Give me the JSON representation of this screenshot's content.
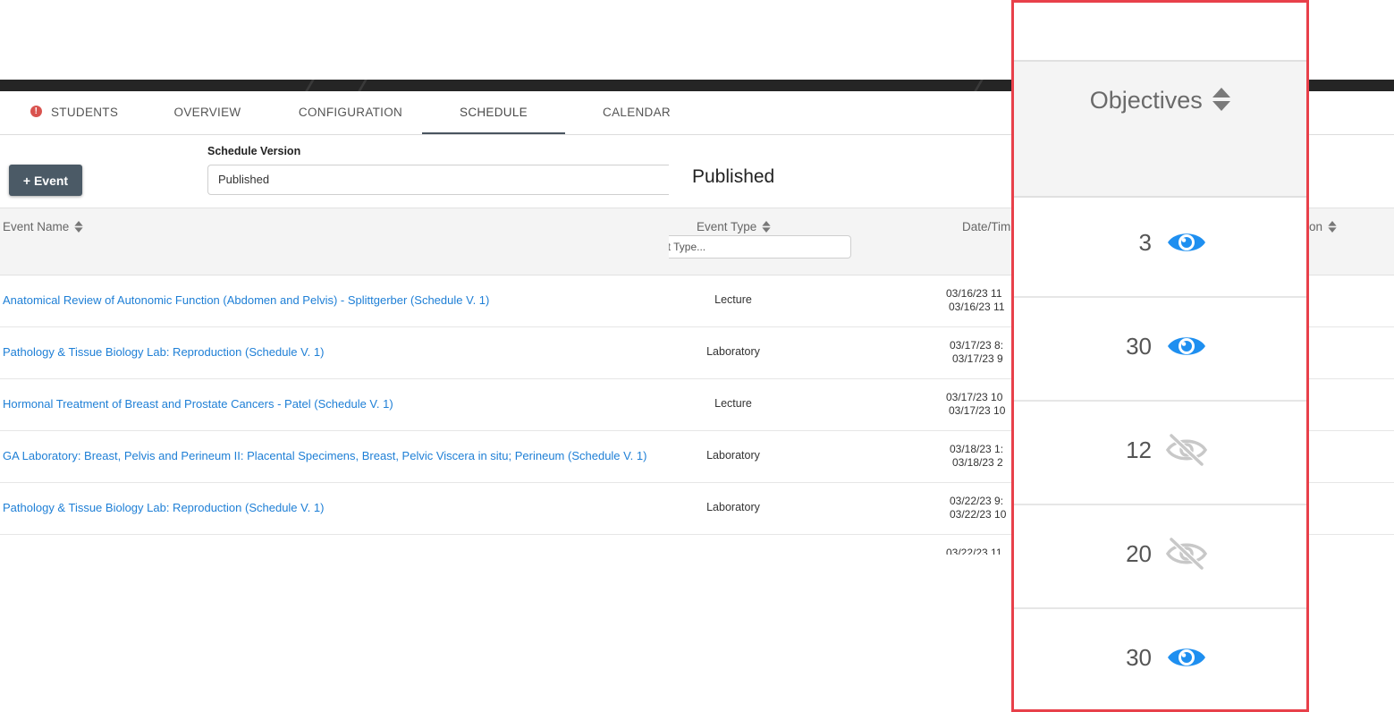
{
  "tabs": [
    {
      "label": "STUDENTS",
      "alert": "!"
    },
    {
      "label": "OVERVIEW"
    },
    {
      "label": "CONFIGURATION"
    },
    {
      "label": "SCHEDULE",
      "active": true
    },
    {
      "label": "CALENDAR"
    }
  ],
  "toolbar": {
    "add_event_label": "+ Event",
    "schedule_version_label": "Schedule Version",
    "schedule_version_value": "Published",
    "published_heading": "Published"
  },
  "table": {
    "headers": {
      "event_name": "Event Name",
      "event_type": "Event Type",
      "event_type_filter_placeholder": "nt Type...",
      "date_time": "Date/Tim",
      "partial_right": "on"
    },
    "rows": [
      {
        "name": "Anatomical Review of Autonomic Function (Abdomen and Pelvis) - Splittgerber (Schedule V. 1)",
        "type": "Lecture",
        "date1": "03/16/23 11",
        "date2": "03/16/23 11"
      },
      {
        "name": "Pathology & Tissue Biology Lab: Reproduction (Schedule V. 1)",
        "type": "Laboratory",
        "date1": "03/17/23 8:",
        "date2": "03/17/23 9"
      },
      {
        "name": "Hormonal Treatment of Breast and Prostate Cancers - Patel (Schedule V. 1)",
        "type": "Lecture",
        "date1": "03/17/23 10",
        "date2": "03/17/23 10"
      },
      {
        "name": "GA Laboratory: Breast, Pelvis and Perineum II: Placental Specimens, Breast, Pelvic Viscera in situ; Perineum (Schedule V. 1)",
        "type": "Laboratory",
        "date1": "03/18/23 1:",
        "date2": "03/18/23 2"
      },
      {
        "name": "Pathology & Tissue Biology Lab: Reproduction (Schedule V. 1)",
        "type": "Laboratory",
        "date1": "03/22/23 9:",
        "date2": "03/22/23 10"
      }
    ],
    "partial_next_date": "03/22/23 11"
  },
  "zoom": {
    "header": "Objectives",
    "rows": [
      {
        "count": "3",
        "visible": true,
        "icon": "eye-icon"
      },
      {
        "count": "30",
        "visible": true,
        "icon": "eye-icon"
      },
      {
        "count": "12",
        "visible": false,
        "icon": "eye-off-icon"
      },
      {
        "count": "20",
        "visible": false,
        "icon": "eye-off-icon"
      },
      {
        "count": "30",
        "visible": true,
        "icon": "eye-icon"
      }
    ]
  },
  "colors": {
    "link": "#1e7fd6",
    "eye_visible": "#1e8ff0",
    "eye_hidden": "#c8c8c8",
    "highlight_border": "#e8404a",
    "button_bg": "#4b5a66",
    "alert": "#d9534f"
  }
}
